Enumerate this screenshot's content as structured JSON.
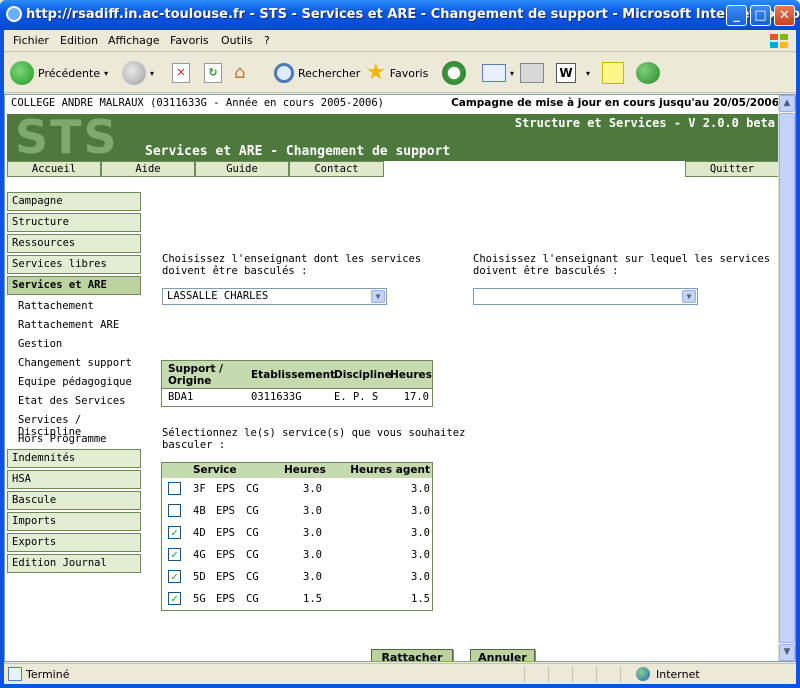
{
  "window": {
    "title": "http://rsadiff.in.ac-toulouse.fr - STS - Services et ARE - Changement de support - Microsoft Internet Explorer",
    "minimize": "_",
    "maximize": "□",
    "close": "✕"
  },
  "menubar": [
    "Fichier",
    "Edition",
    "Affichage",
    "Favoris",
    "Outils",
    "?"
  ],
  "toolbar": {
    "back": "Précédente",
    "search": "Rechercher",
    "favorites": "Favoris"
  },
  "page": {
    "college": "COLLEGE ANDRE MALRAUX (0311633G - Année en cours 2005-2006)",
    "campaign": "Campagne de mise à jour en cours jusqu'au 20/05/2006",
    "logo": "STS",
    "version": "Structure et Services - V 2.0.0 beta",
    "title": "Services et ARE - Changement de support",
    "nav": [
      "Accueil",
      "Aide",
      "Guide",
      "Contact"
    ],
    "quit": "Quitter"
  },
  "leftmenu": {
    "top_items": [
      "Campagne",
      "Structure",
      "Ressources",
      "Services libres",
      "Services et ARE"
    ],
    "sub_items": [
      "Rattachement",
      "Rattachement ARE",
      "Gestion",
      "Changement support",
      "Equipe pédagogique",
      "Etat des Services",
      "Services / Discipline",
      "Hors Programme"
    ],
    "bottom_items": [
      "Indemnités",
      "HSA",
      "Bascule",
      "Imports",
      "Exports",
      "Edition Journal"
    ]
  },
  "form": {
    "source_label_1": "Choisissez l'enseignant dont les services",
    "source_label_2": "doivent être basculés :",
    "source_value": "LASSALLE CHARLES",
    "target_label_1": "Choisissez l'enseignant sur lequel les services",
    "target_label_2": "doivent être basculés :",
    "target_value": "",
    "select_label_1": "Sélectionnez le(s) service(s) que vous souhaitez",
    "select_label_2": "basculer :",
    "attach_button": "Rattacher",
    "cancel_button": "Annuler"
  },
  "support_table": {
    "headers": [
      "Support /",
      "Origine",
      "Etablissement",
      "Discipline",
      "Heures"
    ],
    "row": [
      "BDA1",
      "0311633G",
      "E. P. S",
      "17.0"
    ]
  },
  "service_table": {
    "headers": [
      "Service",
      "Heures",
      "Heures agent"
    ],
    "rows": [
      {
        "cls": "3F",
        "disc": "EPS",
        "type": "CG",
        "hours": "3.0",
        "agent": "3.0",
        "checked": false
      },
      {
        "cls": "4B",
        "disc": "EPS",
        "type": "CG",
        "hours": "3.0",
        "agent": "3.0",
        "checked": false
      },
      {
        "cls": "4D",
        "disc": "EPS",
        "type": "CG",
        "hours": "3.0",
        "agent": "3.0",
        "checked": true
      },
      {
        "cls": "4G",
        "disc": "EPS",
        "type": "CG",
        "hours": "3.0",
        "agent": "3.0",
        "checked": true
      },
      {
        "cls": "5D",
        "disc": "EPS",
        "type": "CG",
        "hours": "3.0",
        "agent": "3.0",
        "checked": true
      },
      {
        "cls": "5G",
        "disc": "EPS",
        "type": "CG",
        "hours": "1.5",
        "agent": "1.5",
        "checked": true
      }
    ]
  },
  "statusbar": {
    "status": "Terminé",
    "zone": "Internet"
  },
  "colors": {
    "banner_green": "#4d7a3c",
    "menu_green": "#e3edd3",
    "header_green": "#c6dab0",
    "xp_blue": "#0a54e0"
  }
}
